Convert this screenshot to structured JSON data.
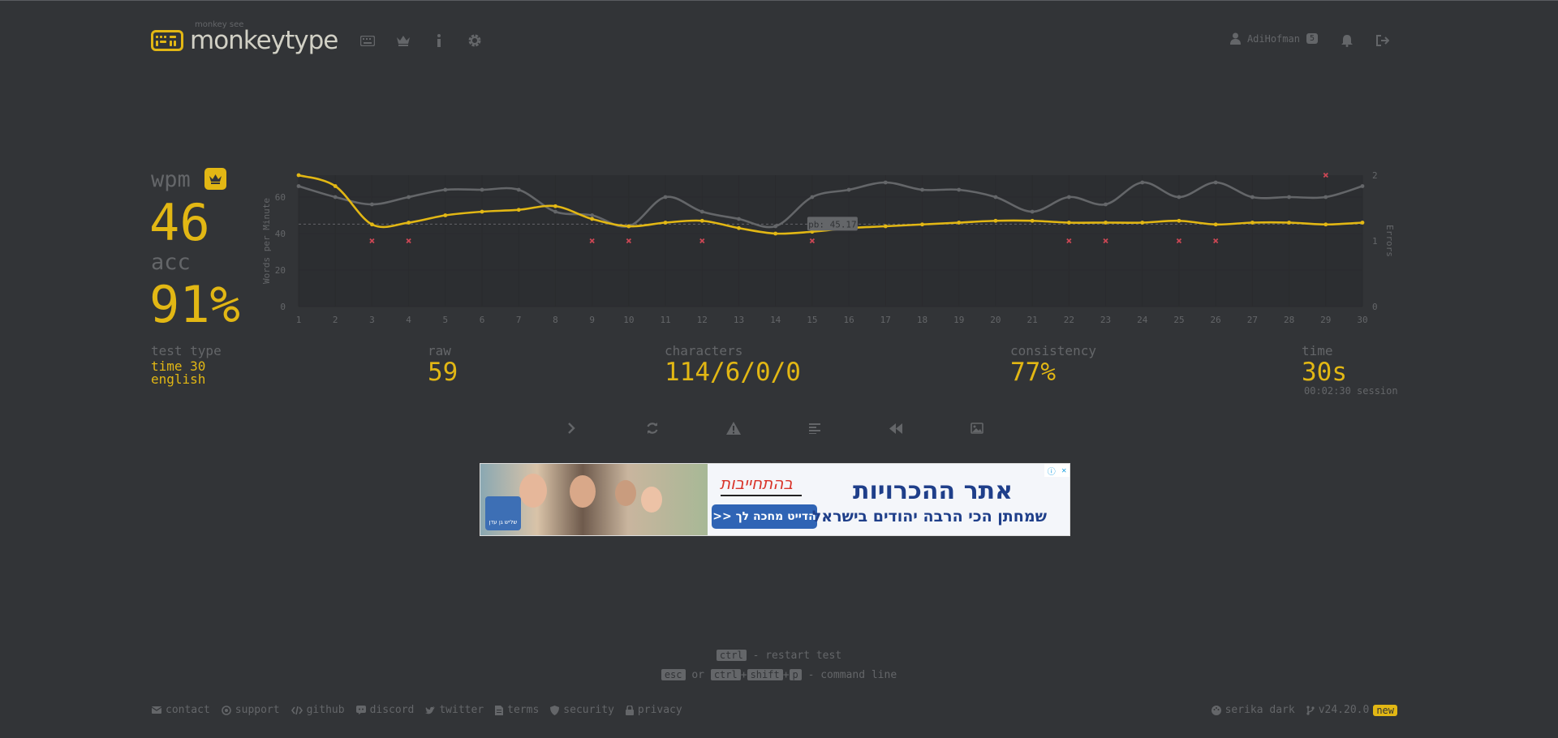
{
  "header": {
    "logo_top": "monkey see",
    "logo_text": "monkeytype",
    "username": "AdiHofman",
    "level": "5"
  },
  "nav_icons": [
    "keyboard-icon",
    "crown-icon",
    "info-icon",
    "gear-icon"
  ],
  "stats": {
    "wpm_label": "wpm",
    "wpm": "46",
    "acc_label": "acc",
    "acc": "91%",
    "test_type_label": "test type",
    "test_type_mode": "time 30",
    "test_type_lang": "english",
    "raw_label": "raw",
    "raw": "59",
    "characters_label": "characters",
    "characters": "114/6/0/0",
    "consistency_label": "consistency",
    "consistency": "77%",
    "time_label": "time",
    "time": "30s",
    "session": "00:02:30 session"
  },
  "chart_data": {
    "type": "line",
    "x": [
      1,
      2,
      3,
      4,
      5,
      6,
      7,
      8,
      9,
      10,
      11,
      12,
      13,
      14,
      15,
      16,
      17,
      18,
      19,
      20,
      21,
      22,
      23,
      24,
      25,
      26,
      27,
      28,
      29,
      30
    ],
    "series": [
      {
        "values": [
          72,
          66,
          45,
          46,
          50,
          52,
          53,
          55,
          48,
          44,
          46,
          47,
          43,
          40,
          41,
          43,
          44,
          45,
          46,
          47,
          47,
          46,
          46,
          46,
          47,
          45,
          46,
          46,
          45,
          46
        ],
        "color": "#e2b714"
      },
      {
        "values": [
          66,
          60,
          56,
          60,
          64,
          64,
          64,
          52,
          50,
          44,
          60,
          52,
          48,
          44,
          60,
          64,
          68,
          64,
          64,
          60,
          52,
          60,
          56,
          68,
          60,
          68,
          60,
          60,
          60,
          66
        ],
        "color": "#646669"
      }
    ],
    "errors": {
      "x": [
        3,
        4,
        9,
        10,
        12,
        15,
        22,
        23,
        25,
        26,
        29
      ],
      "y": [
        1,
        1,
        1,
        1,
        1,
        1,
        1,
        1,
        1,
        1,
        2
      ]
    },
    "ylabel": "Words per Minute",
    "y2label": "Errors",
    "ylim": [
      0,
      72
    ],
    "yticks": [
      "0",
      "20",
      "40",
      "60"
    ],
    "y2lim": [
      0,
      2
    ],
    "y2ticks": [
      "0",
      "1",
      "2"
    ],
    "avg_label": "pb: 45.17",
    "avg_value": 45.17,
    "grid": true
  },
  "actions": [
    "next-test",
    "restart-test",
    "report-issue",
    "words-history",
    "replay",
    "save-screenshot"
  ],
  "shortcuts": {
    "key1": "ctrl",
    "text1": "- restart test",
    "esc": "esc",
    "or": "or",
    "ctrl": "ctrl",
    "shift": "shift",
    "p": "p",
    "plus": "+",
    "text2": "- command line"
  },
  "ad": {
    "commitment": "בהתחייבות",
    "button": "הדייט מחכה לך <<",
    "title": "אתר ההכרויות",
    "subtitle": "שמחתן הכי הרבה יהודים בישראל",
    "logo": "שליש גן עדן"
  },
  "footer": {
    "contact": "contact",
    "support": "support",
    "github": "github",
    "discord": "discord",
    "twitter": "twitter",
    "terms": "terms",
    "security": "security",
    "privacy": "privacy",
    "theme": "serika dark",
    "version": "v24.20.0",
    "new": "new"
  }
}
